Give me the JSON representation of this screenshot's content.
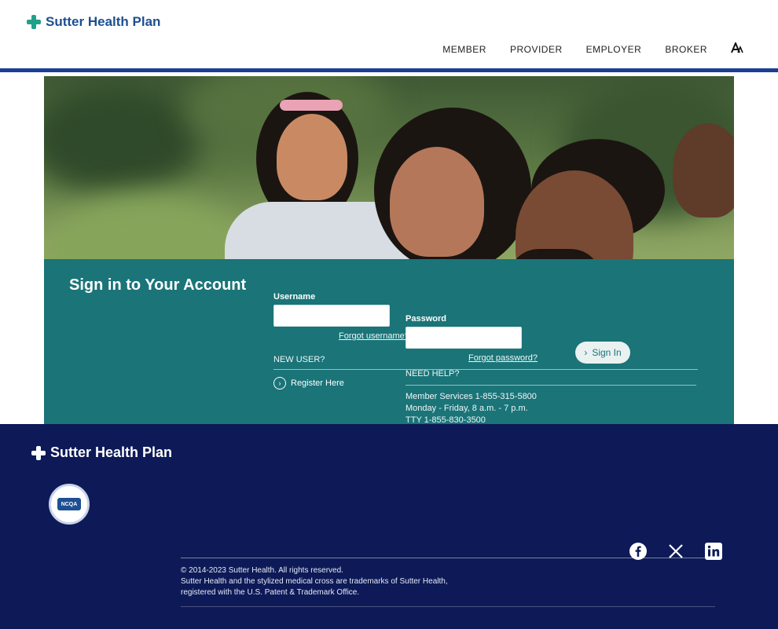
{
  "brand": {
    "name_part1": "Sutter Health",
    "name_part2": "Plan",
    "footer_name": "Sutter Health Plan",
    "badge_text": "NCQA"
  },
  "nav": {
    "items": [
      "MEMBER",
      "PROVIDER",
      "EMPLOYER",
      "BROKER"
    ],
    "a11y_label": "A"
  },
  "signin": {
    "title": "Sign in to Your Account",
    "username_label": "Username",
    "username_value": "",
    "forgot_username": "Forgot username?",
    "password_label": "Password",
    "password_value": "",
    "forgot_password": "Forgot password?",
    "button_label": "Sign In",
    "new_user_label": "NEW USER?",
    "register_label": "Register Here",
    "need_help_label": "NEED HELP?",
    "help_lines": [
      "Member Services 1-855-315-5800",
      "Monday - Friday, 8 a.m. - 7 p.m.",
      "TTY 1-855-830-3500"
    ]
  },
  "footer": {
    "legal_lines": [
      "© 2014-2023 Sutter Health. All rights reserved.",
      "Sutter Health and the stylized medical cross are trademarks of Sutter Health,",
      "registered with the U.S. Patent & Trademark Office."
    ],
    "social": [
      "facebook-icon",
      "x-icon",
      "linkedin-icon"
    ]
  },
  "colors": {
    "primary_teal": "#1a7478",
    "footer_navy": "#0d1a57",
    "header_rule": "#1c3f94",
    "logo_blue": "#1d4f91",
    "logo_green": "#22a08a"
  }
}
